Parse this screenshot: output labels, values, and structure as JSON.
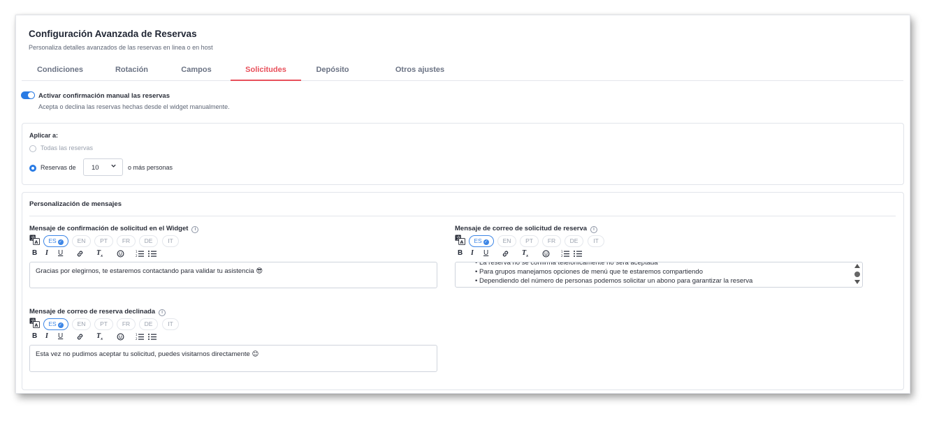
{
  "header": {
    "title": "Configuración Avanzada de Reservas",
    "subtitle": "Personaliza detalles avanzados de las reservas en linea o en host"
  },
  "tabs": [
    {
      "label": "Condiciones",
      "active": false
    },
    {
      "label": "Rotación",
      "active": false
    },
    {
      "label": "Campos",
      "active": false
    },
    {
      "label": "Solicitudes",
      "active": true
    },
    {
      "label": "Depósito",
      "active": false
    },
    {
      "label": "Otros ajustes",
      "active": false
    }
  ],
  "manual_confirmation": {
    "enabled": true,
    "label": "Activar confirmación manual las reservas",
    "description": "Acepta o declina las reservas hechas desde el widget manualmente."
  },
  "apply_to": {
    "title": "Aplicar a:",
    "option_all": "Todas las reservas",
    "option_min_prefix": "Reservas de",
    "selected_count": "10",
    "option_min_suffix": "o más personas",
    "selected_option": "min"
  },
  "messages": {
    "title": "Personalización de mensajes",
    "languages": [
      "ES",
      "EN",
      "PT",
      "FR",
      "DE",
      "IT"
    ],
    "active_language": "ES",
    "toolbar_icons": [
      "bold-icon",
      "italic-icon",
      "underline-icon",
      "link-icon",
      "clear-format-icon",
      "emoji-icon",
      "ordered-list-icon",
      "bullet-list-icon"
    ],
    "widget_confirmation": {
      "label": "Mensaje de confirmación de solicitud en el Widget",
      "text": "Gracias por elegirnos, te estaremos contactando para validar tu asistencia 😎"
    },
    "request_email": {
      "label": "Mensaje de correo de solicitud de reserva",
      "lines": [
        "La reserva no se confirma telefónicamente no será aceptada",
        "Para grupos manejamos opciones de menú que te estaremos compartiendo",
        "Dependiendo del número de personas podemos solicitar un abono para garantizar la reserva"
      ]
    },
    "declined_email": {
      "label": "Mensaje de correo de reserva declinada",
      "text": "Esta vez no pudimos aceptar tu solicitud, puedes visitarnos directamente 😊"
    }
  },
  "colors": {
    "accent_tab": "#e8505b",
    "primary": "#2a7be4"
  }
}
